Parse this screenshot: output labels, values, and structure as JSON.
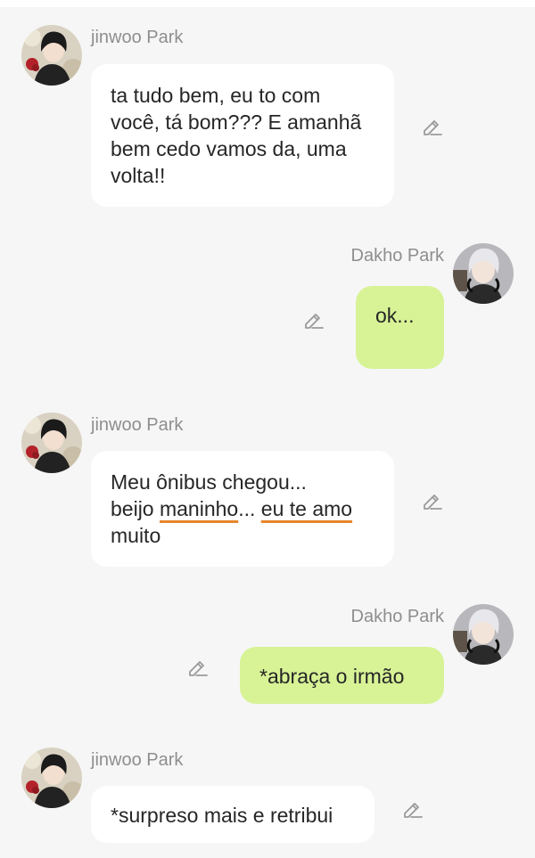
{
  "icons": {
    "edit": "pencil-edit-icon"
  },
  "colors": {
    "background": "#f6f6f6",
    "incoming_bubble": "#ffffff",
    "outgoing_bubble": "#d7f396",
    "name_text": "#8e8e8e",
    "underline": "#e8862a"
  },
  "messages": [
    {
      "sender": "jinwoo Park",
      "direction": "incoming",
      "lines": [
        "ta tudo bem, eu to com",
        "você, tá bom??? E amanhã",
        "bem cedo vamos da, uma",
        "volta!!"
      ]
    },
    {
      "sender": "Dakho Park",
      "direction": "outgoing",
      "lines": [
        "ok..."
      ]
    },
    {
      "sender": "jinwoo Park",
      "direction": "incoming",
      "line1": "Meu ônibus chegou...",
      "line2_prefix": "beijo ",
      "line2_underlined_1": "maninho",
      "line2_mid": "... ",
      "line2_underlined_2": "eu te amo",
      "line3": "muito"
    },
    {
      "sender": "Dakho Park",
      "direction": "outgoing",
      "lines": [
        "*abraça o irmão"
      ]
    },
    {
      "sender": "jinwoo Park",
      "direction": "incoming",
      "lines": [
        "*surpreso mais e retribui"
      ]
    }
  ]
}
